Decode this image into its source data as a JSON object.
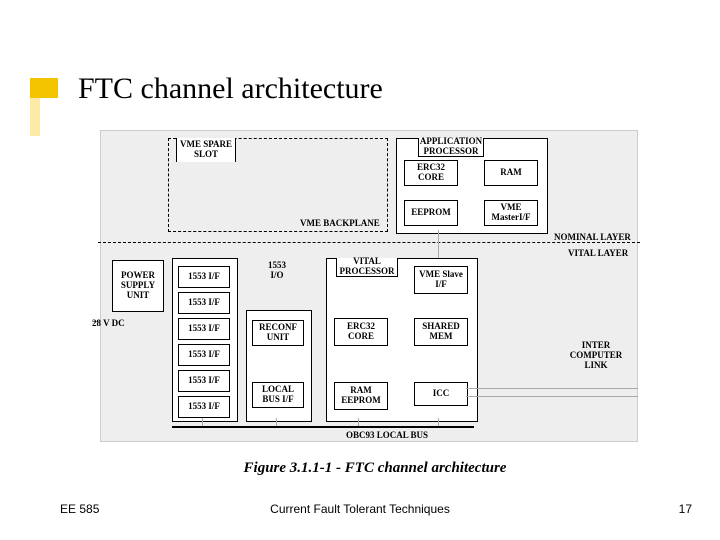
{
  "header": {
    "title": "FTC channel architecture"
  },
  "footer": {
    "left": "EE 585",
    "center": "Current Fault Tolerant Techniques",
    "right": "17"
  },
  "figure": {
    "caption": "Figure 3.1.1-1 - FTC channel architecture",
    "nominal": {
      "vme_spare": "VME SPARE SLOT",
      "backplane": "VME BACKPLANE",
      "app_proc": "APPLICATION PROCESSOR",
      "erc32": "ERC32 CORE",
      "ram": "RAM",
      "eeprom": "EEPROM",
      "vme_master": "VME MasterI/F",
      "layer_label": "NOMINAL LAYER"
    },
    "vital": {
      "psu": "POWER SUPPLY UNIT",
      "dc_in": "28 V DC",
      "b1553_io": "1553 I/O",
      "b1553_if": "1553 I/F",
      "reconf": "RECONF UNIT",
      "local_bus": "LOCAL BUS I/F",
      "vital_proc": "VITAL PROCESSOR",
      "erc32": "ERC32 CORE",
      "ram_eeprom": "RAM EEPROM",
      "vme_slave": "VME Slave I/F",
      "shared_mem": "SHARED MEM",
      "icc": "ICC",
      "layer_label": "VITAL LAYER",
      "icl": "INTER COMPUTER LINK",
      "bus": "OBC93 LOCAL BUS"
    }
  }
}
